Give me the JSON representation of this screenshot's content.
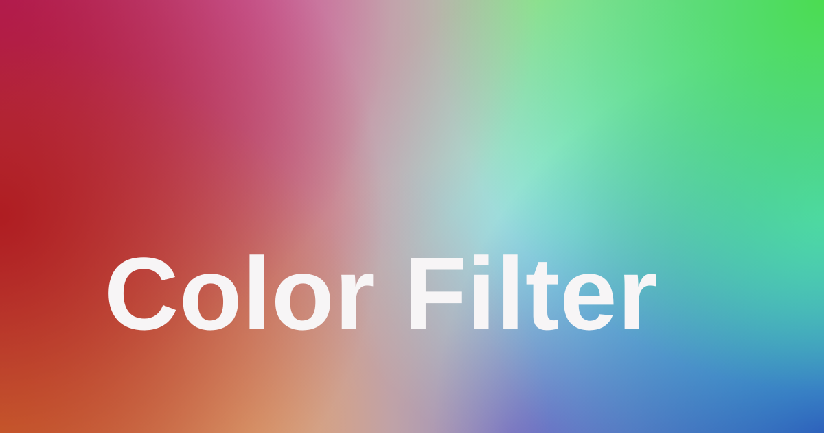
{
  "title": "Color Filter"
}
